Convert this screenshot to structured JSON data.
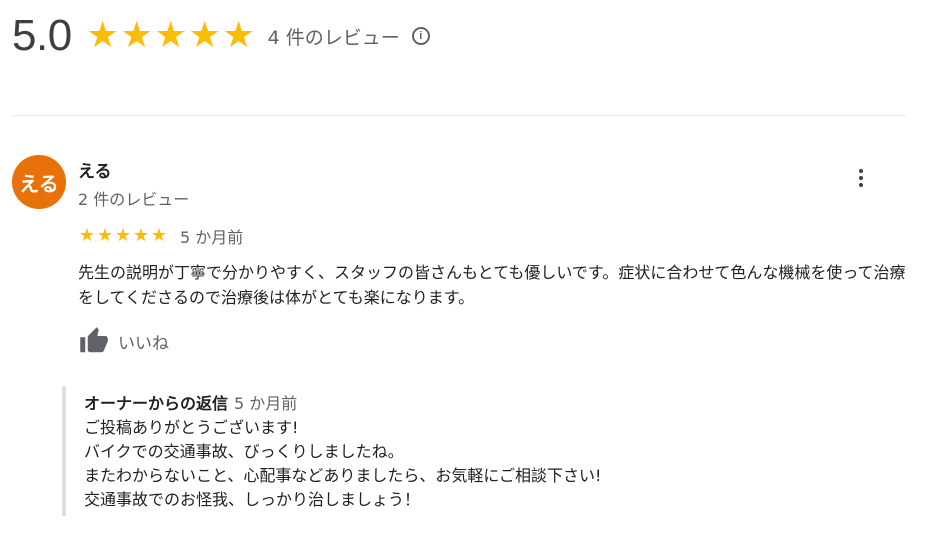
{
  "summary": {
    "rating": "5.0",
    "stars": 5,
    "review_count_label": "4 件のレビュー",
    "info_icon": "info-icon"
  },
  "colors": {
    "star": "#fbbc04",
    "avatar": "#e8710a",
    "muted_text": "#5f6368"
  },
  "review": {
    "avatar_text": "える",
    "reviewer_name": "える",
    "reviewer_review_count": "2 件のレビュー",
    "stars": 5,
    "date": "5 か月前",
    "text": "先生の説明が丁寧で分かりやすく、スタッフの皆さんもとても優しいです。症状に合わせて色んな機械を使って治療をしてくださるので治療後は体がとても楽になります。",
    "like_label": "いいね",
    "more_icon": "more-vert-icon",
    "like_icon": "thumb-up-icon"
  },
  "owner_reply": {
    "title": "オーナーからの返信",
    "date": "5 か月前",
    "lines": [
      "ご投稿ありがとうございます!",
      "バイクでの交通事故、びっくりしましたね。",
      "またわからないこと、心配事などありましたら、お気軽にご相談下さい!",
      "交通事故でのお怪我、しっかり治しましょう！"
    ]
  }
}
